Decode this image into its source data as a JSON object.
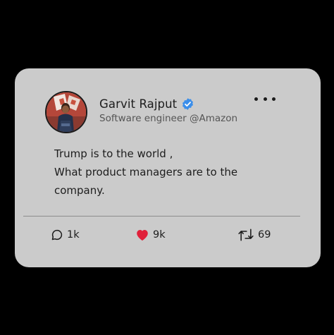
{
  "post": {
    "author": {
      "name": "Garvit Rajput",
      "subtitle": "Software engineer @Amazon",
      "verified": true,
      "verified_color": "#3b8eea",
      "avatar_icon": "profile-photo"
    },
    "menu_icon": "more-horizontal-icon",
    "text_lines": [
      "Trump is to the world ,",
      "What product managers are to the",
      "company."
    ],
    "stats": {
      "comments": "1k",
      "likes": "9k",
      "retweets": "69"
    },
    "colors": {
      "card_background": "#cbcbcb",
      "page_background": "#000000",
      "like_heart": "#e0203a"
    }
  }
}
